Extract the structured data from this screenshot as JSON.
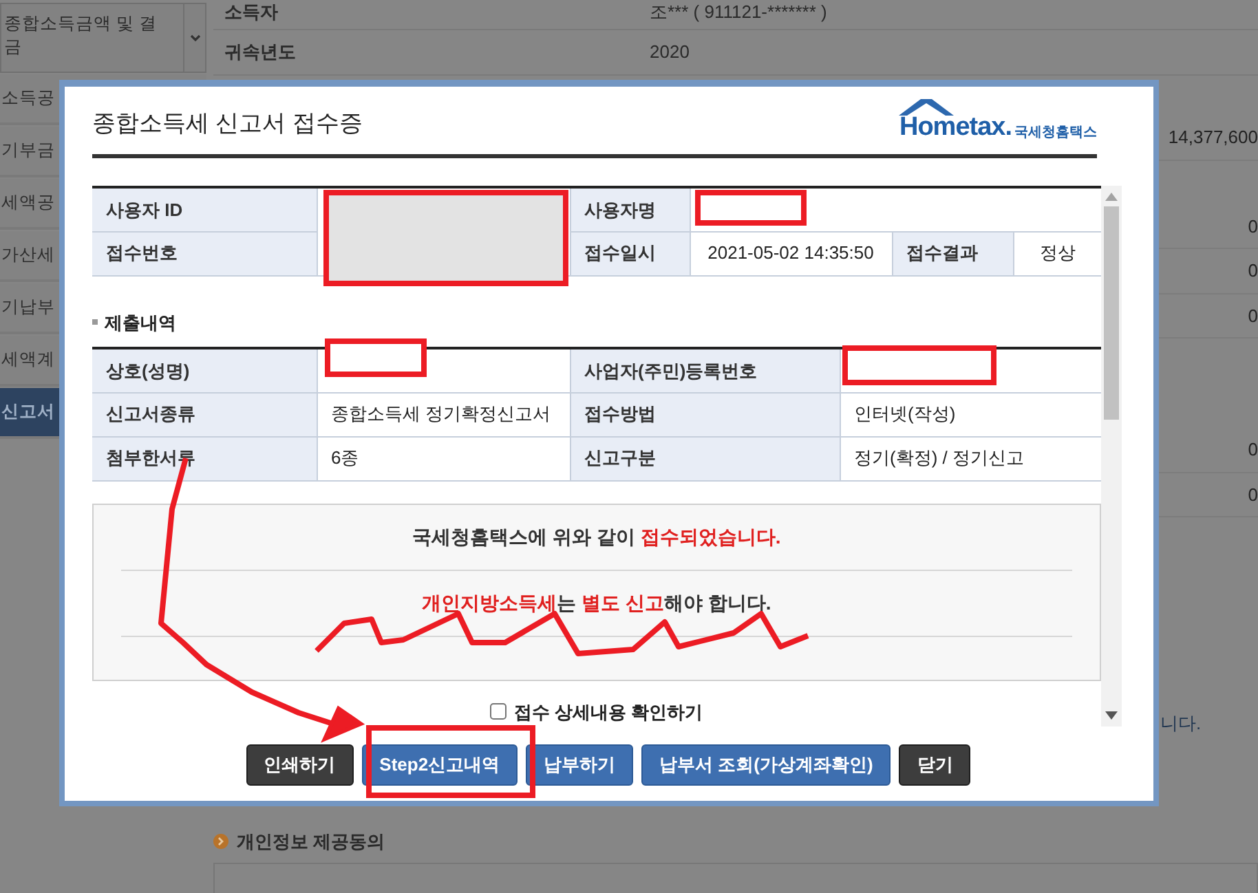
{
  "sidebar": {
    "dropdown": {
      "lines": [
        "종합소득금액 및 결",
        "금"
      ]
    },
    "items": [
      {
        "label": "소득공",
        "selected": false
      },
      {
        "label": "기부금",
        "selected": false
      },
      {
        "label": "세액공",
        "selected": false
      },
      {
        "label": "가산세",
        "selected": false
      },
      {
        "label": "기납부",
        "selected": false
      },
      {
        "label": "세액계",
        "selected": false
      },
      {
        "label": "신고서",
        "selected": true
      }
    ]
  },
  "background": {
    "info_rows": [
      {
        "label": "소득자",
        "value": "조***  (  911121-*******  )"
      },
      {
        "label": "귀속년도",
        "value": "2020"
      }
    ],
    "amounts": [
      "14,377,600",
      "0",
      "0",
      "0",
      "0",
      "0"
    ],
    "notice_fragment": "니다.",
    "consent_section": {
      "title": "개인정보 제공동의"
    }
  },
  "dialog": {
    "title": "종합소득세 신고서 접수증",
    "logo": {
      "wordmark": "Hometax.",
      "subtitle": "국세청홈택스"
    },
    "receipt_table": {
      "user_id_label": "사용자 ID",
      "user_name_label": "사용자명",
      "receipt_no_label": "접수번호",
      "receipt_time_label": "접수일시",
      "receipt_time": "2021-05-02 14:35:50",
      "result_label": "접수결과",
      "result": "정상"
    },
    "section_title": "제출내역",
    "submission_table": [
      {
        "label": "상호(성명)",
        "label_2": "사업자(주민)등록번호"
      },
      {
        "label": "신고서종류",
        "value": "종합소득세 정기확정신고서",
        "label_2": "접수방법",
        "value_2": "인터넷(작성)"
      },
      {
        "label": "첨부한서류",
        "value": "6종",
        "label_2": "신고구분",
        "value_2": "정기(확정) / 정기신고"
      }
    ],
    "messages": [
      [
        {
          "text": "국세청홈택스에 위와 같이 ",
          "highlight": false
        },
        {
          "text": "접수되었습니다.",
          "highlight": true
        }
      ],
      [
        {
          "text": "개인지방소득세",
          "highlight": true
        },
        {
          "text": "는 ",
          "highlight": false
        },
        {
          "text": "별도 신고",
          "highlight": true
        },
        {
          "text": "해야 합니다.",
          "highlight": false
        }
      ]
    ],
    "detail_checkbox": {
      "label": "접수 상세내용 확인하기",
      "checked": false
    },
    "buttons": [
      {
        "label": "인쇄하기",
        "kind": "dark"
      },
      {
        "label": "Step2신고내역",
        "kind": "blue"
      },
      {
        "label": "납부하기",
        "kind": "blue"
      },
      {
        "label": "납부서 조회(가상계좌확인)",
        "kind": "blue"
      },
      {
        "label": "닫기",
        "kind": "dark"
      }
    ]
  }
}
